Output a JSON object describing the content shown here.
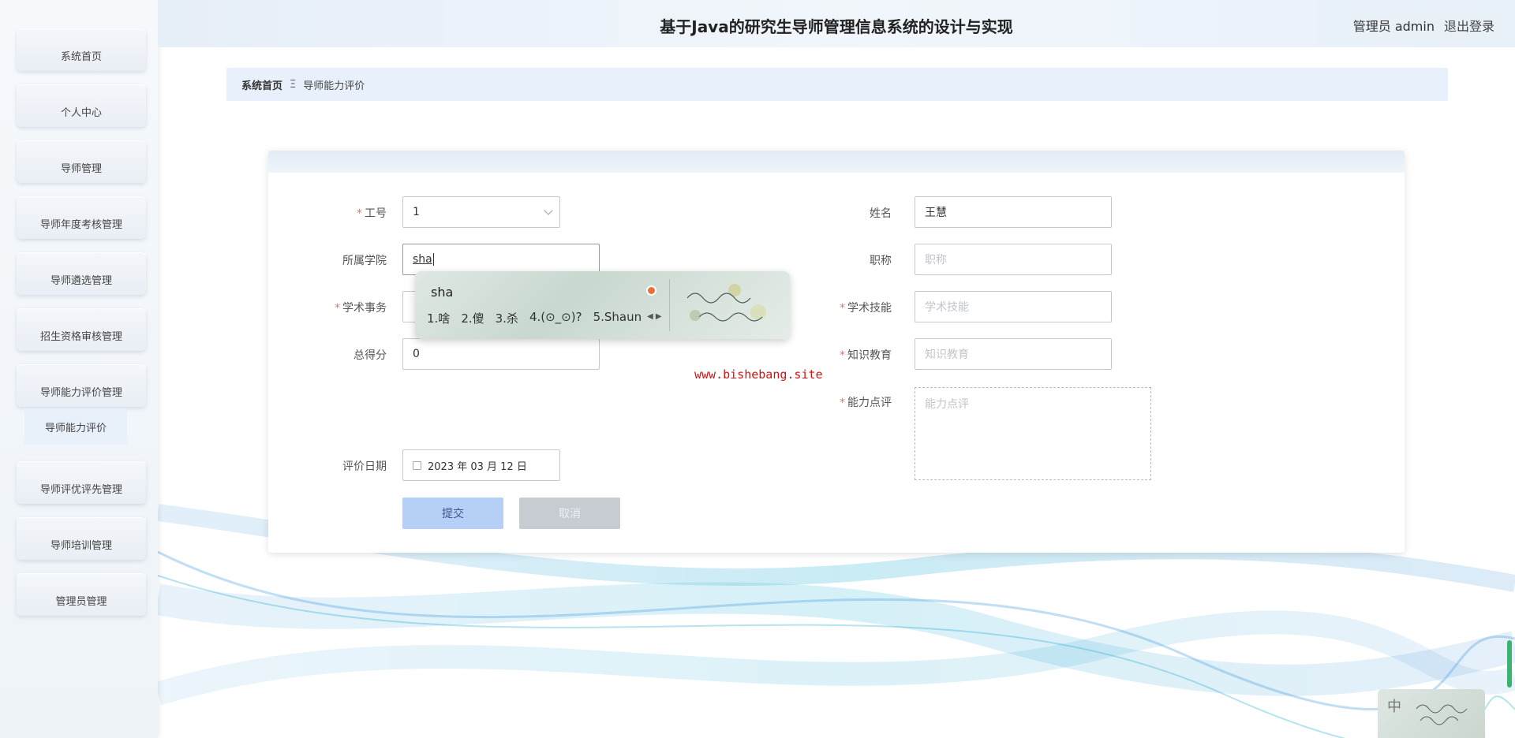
{
  "header": {
    "title": "基于Java的研究生导师管理信息系统的设计与实现",
    "user": "管理员 admin",
    "logout": "退出登录"
  },
  "sidebar": {
    "items": [
      {
        "label": "系统首页"
      },
      {
        "label": "个人中心"
      },
      {
        "label": "导师管理"
      },
      {
        "label": "导师年度考核管理"
      },
      {
        "label": "导师遴选管理"
      },
      {
        "label": "招生资格审核管理"
      },
      {
        "label": "导师能力评价管理"
      },
      {
        "label": "导师评优评先管理"
      },
      {
        "label": "导师培训管理"
      },
      {
        "label": "管理员管理"
      }
    ],
    "submenu": {
      "label": "导师能力评价"
    }
  },
  "breadcrumb": {
    "home": "系统首页",
    "separator": "Ξ",
    "current": "导师能力评价"
  },
  "form": {
    "gonghao": {
      "label": "工号",
      "value": "1"
    },
    "xingming": {
      "label": "姓名",
      "value": "王慧"
    },
    "xueyuan": {
      "label": "所属学院",
      "value": "sha"
    },
    "zhicheng": {
      "label": "职称",
      "placeholder": "职称"
    },
    "xueshushiwu": {
      "label": "学术事务"
    },
    "xueshujineng": {
      "label": "学术技能",
      "placeholder": "学术技能"
    },
    "zongdefen": {
      "label": "总得分",
      "value": "0"
    },
    "zhishijiaoyu": {
      "label": "知识教育",
      "placeholder": "知识教育"
    },
    "nenglidianping": {
      "label": "能力点评",
      "placeholder": "能力点评"
    },
    "pingjiariqi": {
      "label": "评价日期",
      "value": "2023 年 03 月 12 日"
    },
    "submit": "提交",
    "cancel": "取消"
  },
  "ime": {
    "composition": "sha",
    "candidates": [
      "1.啥",
      "2.傻",
      "3.杀",
      "4.(⊙_⊙)?",
      "5.Shaun"
    ],
    "status_lang": "中"
  },
  "watermark": "www.bishebang.site"
}
